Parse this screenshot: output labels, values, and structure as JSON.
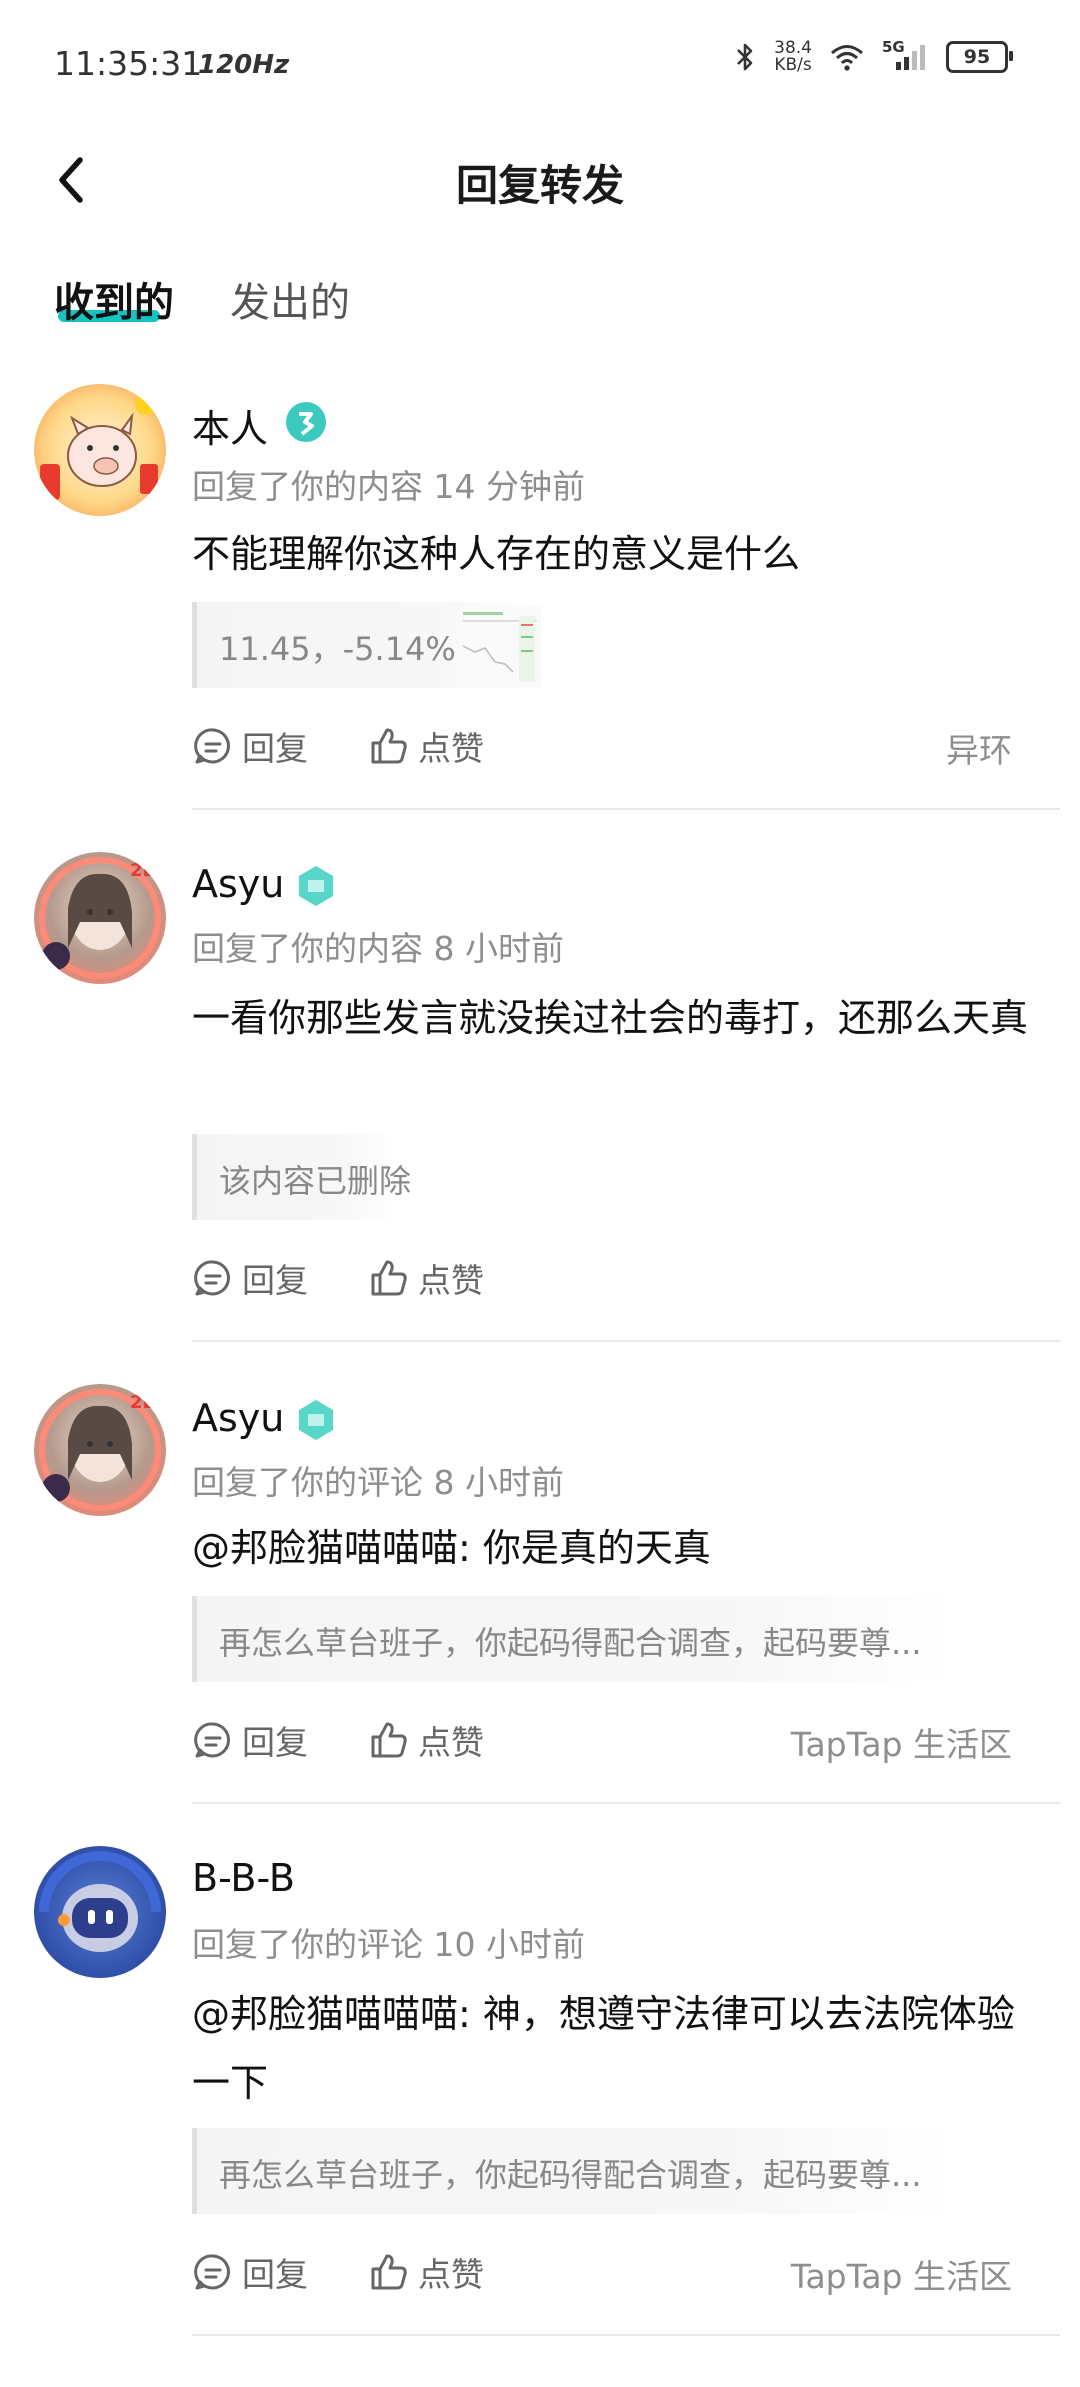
{
  "status_bar": {
    "time": "11:35:31",
    "refresh_rate": "120Hz",
    "net_speed_value": "38.4",
    "net_speed_unit": "KB/s",
    "network": "5G",
    "battery": "95"
  },
  "header": {
    "title": "回复转发"
  },
  "tabs": [
    {
      "label": "收到的",
      "active": true
    },
    {
      "label": "发出的",
      "active": false
    }
  ],
  "items": [
    {
      "username": "本人",
      "meta": "回复了你的内容 14 分钟前",
      "content": "不能理解你这种人存在的意义是什么",
      "quote": "11.45，-5.14%",
      "reply_label": "回复",
      "like_label": "点赞",
      "source": "异环"
    },
    {
      "username": "Asyu",
      "meta": "回复了你的内容 8 小时前",
      "content": "一看你那些发言就没挨过社会的毒打，还那么天真",
      "quote": "该内容已删除",
      "reply_label": "回复",
      "like_label": "点赞",
      "source": ""
    },
    {
      "username": "Asyu",
      "meta": "回复了你的评论 8 小时前",
      "content": "@邦脸猫喵喵喵: 你是真的天真",
      "quote": "再怎么草台班子，你起码得配合调查，起码要尊...",
      "reply_label": "回复",
      "like_label": "点赞",
      "source": "TapTap 生活区"
    },
    {
      "username": "B-B-B",
      "meta": "回复了你的评论 10 小时前",
      "content": "@邦脸猫喵喵喵: 神，想遵守法律可以去法院体验一下",
      "quote": "再怎么草台班子，你起码得配合调查，起码要尊...",
      "reply_label": "回复",
      "like_label": "点赞",
      "source": "TapTap 生活区"
    }
  ],
  "colors": {
    "accent": "#16c2c2",
    "meta_text": "#8e8e8e",
    "divider": "#e8e8e8"
  },
  "icons": [
    "back-arrow-icon",
    "bluetooth-icon",
    "wifi-icon",
    "signal-icon",
    "comment-icon",
    "thumbs-up-icon",
    "level-badge-icon",
    "verified-badge-icon"
  ]
}
